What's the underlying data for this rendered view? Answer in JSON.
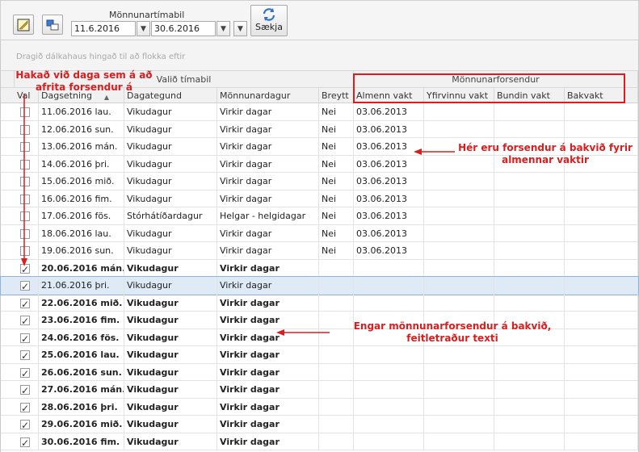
{
  "toolbar": {
    "period_label": "Mönnunartímabil",
    "date_from": "11.6.2016",
    "date_to": "30.6.2016",
    "fetch_label": "Sækja"
  },
  "grid": {
    "group_hint": "Dragið dálkahaus hingað til að flokka eftir",
    "bands": {
      "selected_period": "Valið tímabil",
      "staffing_basis": "Mönnunarforsendur"
    },
    "columns": [
      "Val",
      "Dagsetning",
      "Dagategund",
      "Mönnunardagur",
      "Breytt",
      "Almenn vakt",
      "Yfirvinnu vakt",
      "Bundin vakt",
      "Bakvakt"
    ],
    "rows": [
      {
        "checked": false,
        "date": "11.06.2016 lau.",
        "daytype": "Vikudagur",
        "staffday": "Virkir dagar",
        "changed": "Nei",
        "general": "03.06.2013",
        "bold": false
      },
      {
        "checked": false,
        "date": "12.06.2016 sun.",
        "daytype": "Vikudagur",
        "staffday": "Virkir dagar",
        "changed": "Nei",
        "general": "03.06.2013",
        "bold": false
      },
      {
        "checked": false,
        "date": "13.06.2016 mán.",
        "daytype": "Vikudagur",
        "staffday": "Virkir dagar",
        "changed": "Nei",
        "general": "03.06.2013",
        "bold": false
      },
      {
        "checked": false,
        "date": "14.06.2016 þri.",
        "daytype": "Vikudagur",
        "staffday": "Virkir dagar",
        "changed": "Nei",
        "general": "03.06.2013",
        "bold": false
      },
      {
        "checked": false,
        "date": "15.06.2016 mið.",
        "daytype": "Vikudagur",
        "staffday": "Virkir dagar",
        "changed": "Nei",
        "general": "03.06.2013",
        "bold": false
      },
      {
        "checked": false,
        "date": "16.06.2016 fim.",
        "daytype": "Vikudagur",
        "staffday": "Virkir dagar",
        "changed": "Nei",
        "general": "03.06.2013",
        "bold": false
      },
      {
        "checked": false,
        "date": "17.06.2016 fös.",
        "daytype": "Stórhátíðardagur",
        "staffday": "Helgar - helgidagar",
        "changed": "Nei",
        "general": "03.06.2013",
        "bold": false
      },
      {
        "checked": false,
        "date": "18.06.2016 lau.",
        "daytype": "Vikudagur",
        "staffday": "Virkir dagar",
        "changed": "Nei",
        "general": "03.06.2013",
        "bold": false
      },
      {
        "checked": false,
        "date": "19.06.2016 sun.",
        "daytype": "Vikudagur",
        "staffday": "Virkir dagar",
        "changed": "Nei",
        "general": "03.06.2013",
        "bold": false
      },
      {
        "checked": true,
        "date": "20.06.2016 mán.",
        "daytype": "Vikudagur",
        "staffday": "Virkir dagar",
        "changed": "",
        "general": "",
        "bold": true
      },
      {
        "checked": true,
        "date": "21.06.2016 þri.",
        "daytype": "Vikudagur",
        "staffday": "Virkir dagar",
        "changed": "",
        "general": "",
        "bold": false,
        "selected": true
      },
      {
        "checked": true,
        "date": "22.06.2016 mið.",
        "daytype": "Vikudagur",
        "staffday": "Virkir dagar",
        "changed": "",
        "general": "",
        "bold": true
      },
      {
        "checked": true,
        "date": "23.06.2016 fim.",
        "daytype": "Vikudagur",
        "staffday": "Virkir dagar",
        "changed": "",
        "general": "",
        "bold": true
      },
      {
        "checked": true,
        "date": "24.06.2016 fös.",
        "daytype": "Vikudagur",
        "staffday": "Virkir dagar",
        "changed": "",
        "general": "",
        "bold": true
      },
      {
        "checked": true,
        "date": "25.06.2016 lau.",
        "daytype": "Vikudagur",
        "staffday": "Virkir dagar",
        "changed": "",
        "general": "",
        "bold": true
      },
      {
        "checked": true,
        "date": "26.06.2016 sun.",
        "daytype": "Vikudagur",
        "staffday": "Virkir dagar",
        "changed": "",
        "general": "",
        "bold": true
      },
      {
        "checked": true,
        "date": "27.06.2016 mán.",
        "daytype": "Vikudagur",
        "staffday": "Virkir dagar",
        "changed": "",
        "general": "",
        "bold": true
      },
      {
        "checked": true,
        "date": "28.06.2016 þri.",
        "daytype": "Vikudagur",
        "staffday": "Virkir dagar",
        "changed": "",
        "general": "",
        "bold": true
      },
      {
        "checked": true,
        "date": "29.06.2016 mið.",
        "daytype": "Vikudagur",
        "staffday": "Virkir dagar",
        "changed": "",
        "general": "",
        "bold": true
      },
      {
        "checked": true,
        "date": "30.06.2016 fim.",
        "daytype": "Vikudagur",
        "staffday": "Virkir dagar",
        "changed": "",
        "general": "",
        "bold": true
      }
    ]
  },
  "annotations": {
    "check_days": "Hakað við daga sem á að afrita forsendur á",
    "basis_behind": "Hér eru forsendur á bakvið fyrir almennar vaktir",
    "no_basis": "Engar mönnunarforsendur á bakvið, feitletraður texti"
  },
  "colors": {
    "annotation": "#d81e1e",
    "selected_row": "#dfeaf7"
  },
  "icons": {
    "edit": "edit-icon",
    "copy": "copy-window-icon",
    "refresh": "refresh-icon",
    "dropdown": "chevron-down-icon"
  }
}
